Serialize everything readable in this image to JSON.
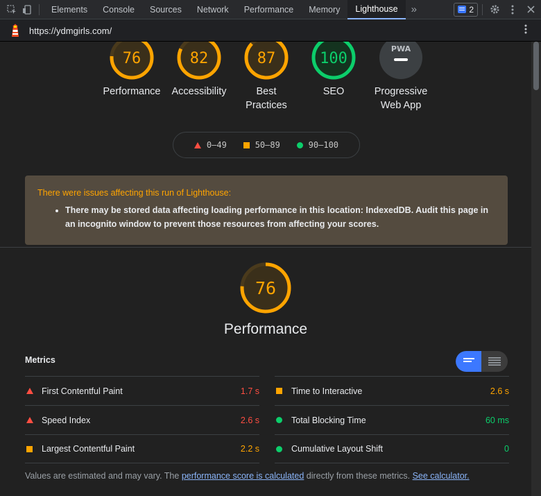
{
  "devtools": {
    "tabs": [
      "Elements",
      "Console",
      "Sources",
      "Network",
      "Performance",
      "Memory",
      "Lighthouse"
    ],
    "active_tab": "Lighthouse",
    "issues_count": "2"
  },
  "url": "https://ydmgirls.com/",
  "categories": [
    {
      "score": "76",
      "label": "Performance",
      "value": 76,
      "color": "#ffa400"
    },
    {
      "score": "82",
      "label": "Accessibility",
      "value": 82,
      "color": "#ffa400"
    },
    {
      "score": "87",
      "label": "Best Practices",
      "value": 87,
      "color": "#ffa400"
    },
    {
      "score": "100",
      "label": "SEO",
      "value": 100,
      "color": "#0cce6b"
    },
    {
      "score": "",
      "label": "Progressive Web App",
      "badge": "PWA"
    }
  ],
  "legend": {
    "fail": "0–49",
    "average": "50–89",
    "pass": "90–100"
  },
  "warning": {
    "title": "There were issues affecting this run of Lighthouse:",
    "items": [
      "There may be stored data affecting loading performance in this location: IndexedDB. Audit this page in an incognito window to prevent those resources from affecting your scores."
    ]
  },
  "performance": {
    "score": "76",
    "value": 76,
    "title": "Performance"
  },
  "metrics": {
    "header": "Metrics",
    "left": [
      {
        "name": "First Contentful Paint",
        "value": "1.7 s",
        "status": "fail"
      },
      {
        "name": "Speed Index",
        "value": "2.6 s",
        "status": "fail"
      },
      {
        "name": "Largest Contentful Paint",
        "value": "2.2 s",
        "status": "average"
      }
    ],
    "right": [
      {
        "name": "Time to Interactive",
        "value": "2.6 s",
        "status": "average"
      },
      {
        "name": "Total Blocking Time",
        "value": "60 ms",
        "status": "pass"
      },
      {
        "name": "Cumulative Layout Shift",
        "value": "0",
        "status": "pass"
      }
    ]
  },
  "footnote": {
    "text1": "Values are estimated and may vary. The ",
    "link1": "performance score is calculated",
    "text2": " directly from these metrics. ",
    "link2": "See calculator."
  },
  "colors": {
    "fail": "#ff4e42",
    "average": "#ffa400",
    "pass": "#0cce6b",
    "accent": "#3c78ff"
  }
}
